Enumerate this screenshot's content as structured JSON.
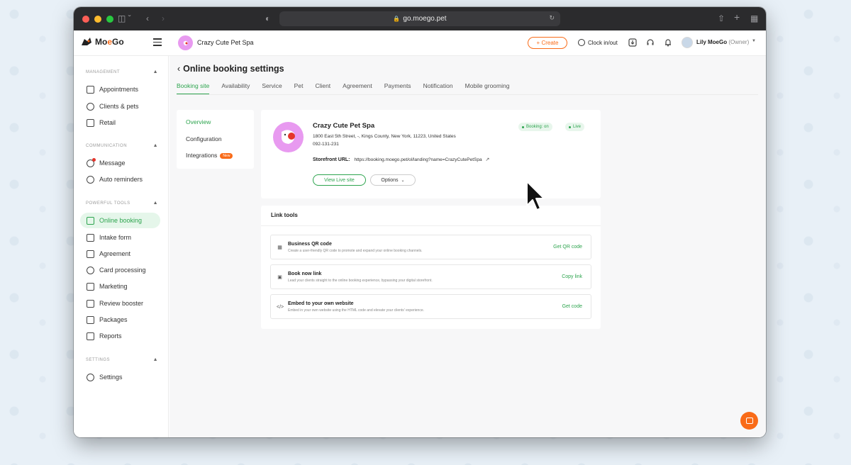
{
  "browser": {
    "url": "go.moego.pet"
  },
  "app": {
    "logo_text_a": "Mo",
    "logo_text_b": "e",
    "logo_text_c": "Go",
    "business_name": "Crazy Cute Pet Spa",
    "create_label": "+ Create",
    "clock_label": "Clock in/out",
    "user_name": "Lily MoeGo",
    "user_role": "(Owner)"
  },
  "sidebar": {
    "sections": [
      {
        "title": "MANAGEMENT",
        "items": [
          "Appointments",
          "Clients & pets",
          "Retail"
        ]
      },
      {
        "title": "COMMUNICATION",
        "items": [
          "Message",
          "Auto reminders"
        ]
      },
      {
        "title": "POWERFUL TOOLS",
        "items": [
          "Online booking",
          "Intake form",
          "Agreement",
          "Card processing",
          "Marketing",
          "Review booster",
          "Packages",
          "Reports"
        ]
      },
      {
        "title": "SETTINGS",
        "items": [
          "Settings"
        ]
      }
    ]
  },
  "page": {
    "title": "Online booking settings",
    "tabs": [
      "Booking site",
      "Availability",
      "Service",
      "Pet",
      "Client",
      "Agreement",
      "Payments",
      "Notification",
      "Mobile grooming"
    ],
    "subnav": [
      "Overview",
      "Configuration",
      "Integrations"
    ],
    "new_badge": "New"
  },
  "site_card": {
    "name": "Crazy Cute Pet Spa",
    "address": "1800 East 5th Street, -, Kings County, New York, 11223, United States",
    "phone": "092-131-231",
    "storefront_label": "Storefront URL:",
    "storefront_url": "https://booking.moego.pet/ol/landing?name=CrazyCutePetSpa",
    "status_booking": "Booking: on",
    "status_live": "Live",
    "view_live_label": "View Live site",
    "options_label": "Options"
  },
  "link_tools": {
    "title": "Link tools",
    "rows": [
      {
        "name": "Business QR code",
        "desc": "Create a user-friendly QR code to promote and expand your online booking channels.",
        "action": "Get QR code"
      },
      {
        "name": "Book now link",
        "desc": "Lead your clients straight to the online booking experience, bypassing your digital storefront.",
        "action": "Copy link"
      },
      {
        "name": "Embed to your own website",
        "desc": "Embed in your own website using the HTML code and elevate your clients' experience.",
        "action": "Get code"
      }
    ]
  },
  "colors": {
    "accent_green": "#2da44e",
    "accent_orange": "#f96b18"
  }
}
